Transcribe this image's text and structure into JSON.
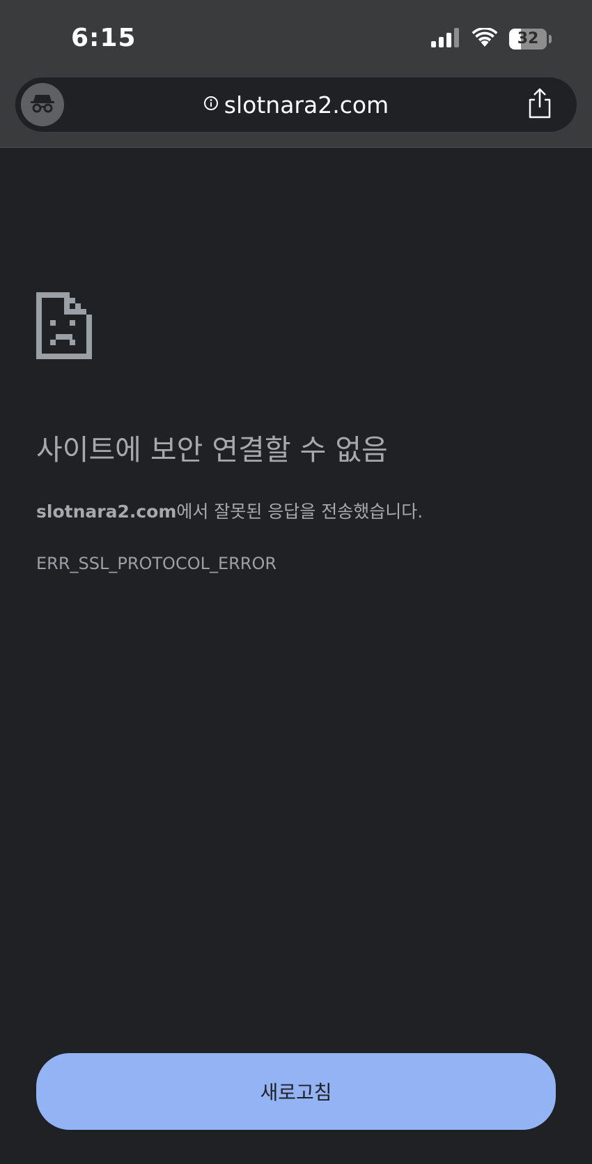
{
  "status_bar": {
    "time": "6:15",
    "battery_level": "32",
    "battery_fraction": 0.32,
    "icons": [
      "cellular-signal-icon",
      "wifi-icon",
      "battery-icon"
    ]
  },
  "address_bar": {
    "url": "slotnara2.com",
    "icons": [
      "incognito-icon",
      "site-info-icon",
      "share-icon"
    ]
  },
  "error_page": {
    "icon": "sad-page-icon",
    "title": "사이트에 보안 연결할 수 없음",
    "domain": "slotnara2.com",
    "message": "에서 잘못된 응답을 전송했습니다.",
    "error_code": "ERR_SSL_PROTOCOL_ERROR",
    "reload_label": "새로고침"
  },
  "colors": {
    "chrome_bg": "#3a3b3d",
    "page_bg": "#202124",
    "text_muted": "#a8a9ab",
    "accent_button": "#94b3f5"
  }
}
